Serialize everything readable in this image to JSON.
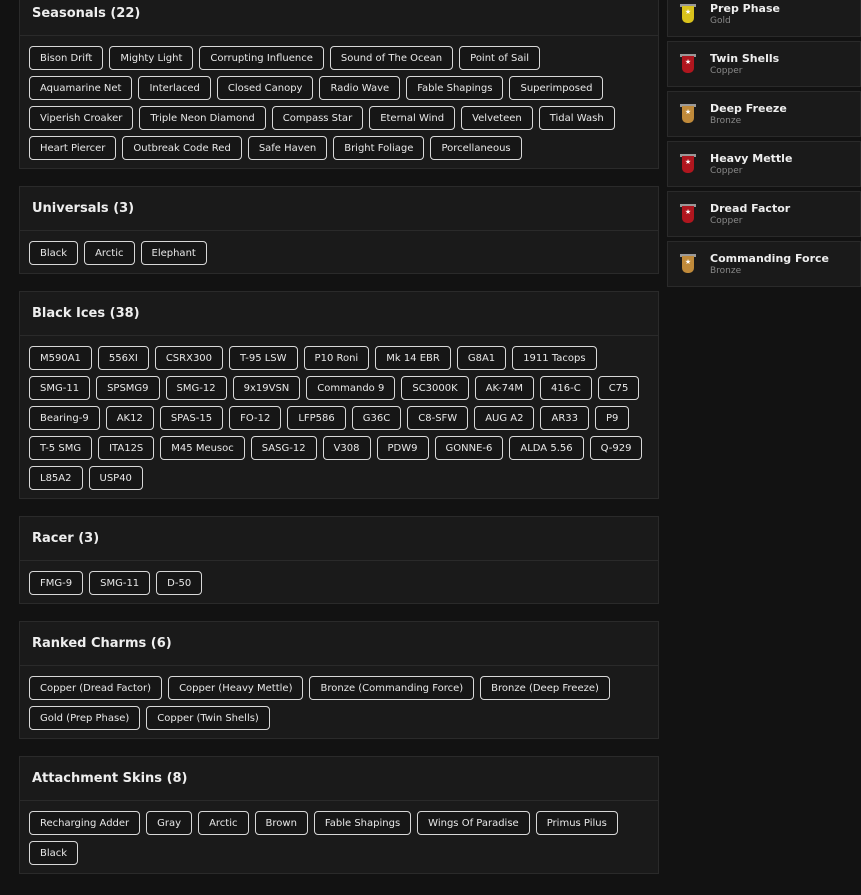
{
  "sections": [
    {
      "title": "Seasonals (22)",
      "items": [
        "Bison Drift",
        "Mighty Light",
        "Corrupting Influence",
        "Sound of The Ocean",
        "Point of Sail",
        "Aquamarine Net",
        "Interlaced",
        "Closed Canopy",
        "Radio Wave",
        "Fable Shapings",
        "Superimposed",
        "Viperish Croaker",
        "Triple Neon Diamond",
        "Compass Star",
        "Eternal Wind",
        "Velveteen",
        "Tidal Wash",
        "Heart Piercer",
        "Outbreak Code Red",
        "Safe Haven",
        "Bright Foliage",
        "Porcellaneous"
      ]
    },
    {
      "title": "Universals (3)",
      "items": [
        "Black",
        "Arctic",
        "Elephant"
      ]
    },
    {
      "title": "Black Ices (38)",
      "items": [
        "M590A1",
        "556XI",
        "CSRX300",
        "T-95 LSW",
        "P10 Roni",
        "Mk 14 EBR",
        "G8A1",
        "1911 Tacops",
        "SMG-11",
        "SPSMG9",
        "SMG-12",
        "9x19VSN",
        "Commando 9",
        "SC3000K",
        "AK-74M",
        "416-C",
        "C75",
        "Bearing-9",
        "AK12",
        "SPAS-15",
        "FO-12",
        "LFP586",
        "G36C",
        "C8-SFW",
        "AUG A2",
        "AR33",
        "P9",
        "T-5 SMG",
        "ITA12S",
        "M45 Meusoc",
        "SASG-12",
        "V308",
        "PDW9",
        "GONNE-6",
        "ALDA 5.56",
        "Q-929",
        "L85A2",
        "USP40"
      ]
    },
    {
      "title": "Racer (3)",
      "items": [
        "FMG-9",
        "SMG-11",
        "D-50"
      ]
    },
    {
      "title": "Ranked Charms (6)",
      "items": [
        "Copper (Dread Factor)",
        "Copper (Heavy Mettle)",
        "Bronze (Commanding Force)",
        "Bronze (Deep Freeze)",
        "Gold (Prep Phase)",
        "Copper (Twin Shells)"
      ]
    },
    {
      "title": "Attachment Skins (8)",
      "items": [
        "Recharging Adder",
        "Gray",
        "Arctic",
        "Brown",
        "Fable Shapings",
        "Wings Of Paradise",
        "Primus Pilus",
        "Black"
      ]
    }
  ],
  "charms": [
    {
      "name": "Prep Phase",
      "tier": "Gold",
      "color": "#d9c21c"
    },
    {
      "name": "Twin Shells",
      "tier": "Copper",
      "color": "#b0161e"
    },
    {
      "name": "Deep Freeze",
      "tier": "Bronze",
      "color": "#c08a3a"
    },
    {
      "name": "Heavy Mettle",
      "tier": "Copper",
      "color": "#b0161e"
    },
    {
      "name": "Dread Factor",
      "tier": "Copper",
      "color": "#b0161e"
    },
    {
      "name": "Commanding Force",
      "tier": "Bronze",
      "color": "#c08a3a"
    }
  ]
}
